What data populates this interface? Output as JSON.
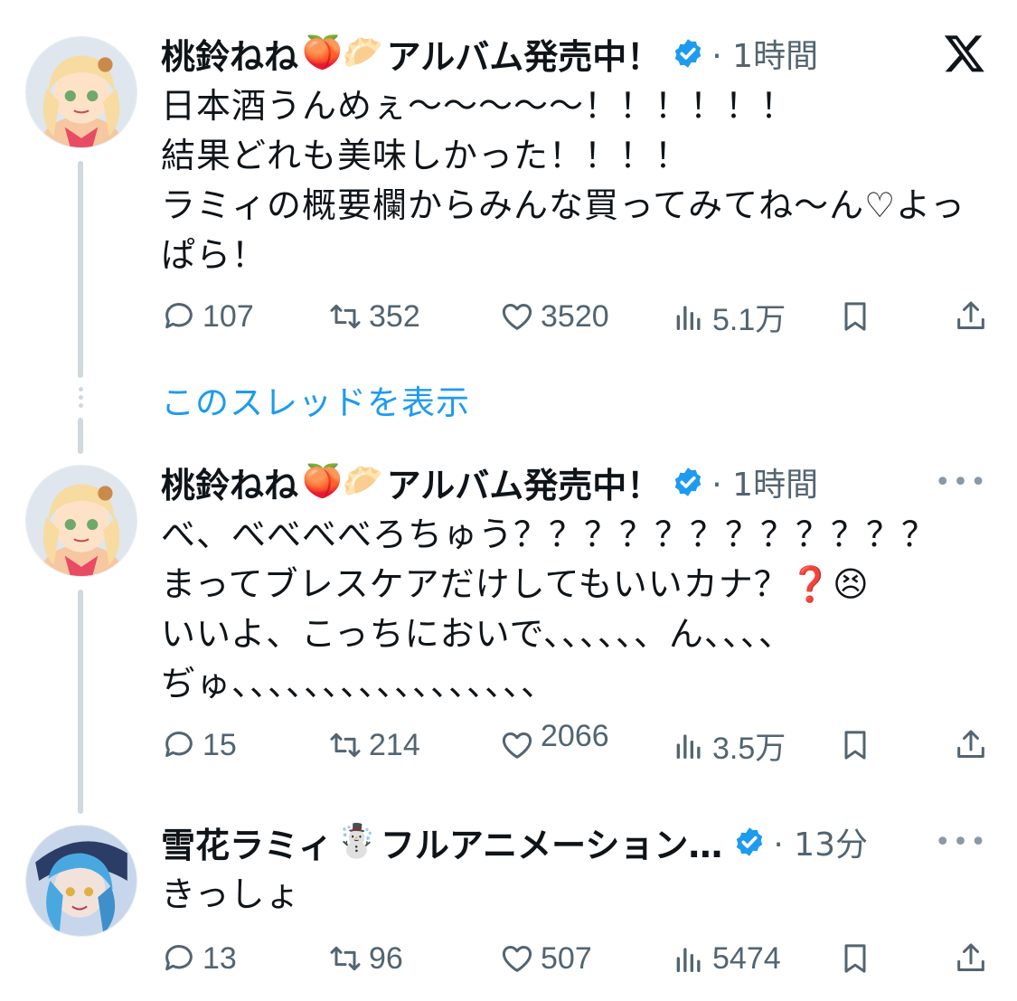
{
  "tweets": [
    {
      "name": "桃鈴ねね",
      "name_emoji": "🍑🥟",
      "name_suffix": "アルバム発売中！",
      "time": "· 1時間",
      "text": "日本酒うんめぇ〜〜〜〜〜！！！！！！\n結果どれも美味しかった！！！！\nラミィの概要欄からみんな買ってみてね〜ん♡よっぱら！",
      "replies": "107",
      "retweets": "352",
      "likes": "3520",
      "views": "5.1万"
    },
    {
      "name": "桃鈴ねね",
      "name_emoji": "🍑🥟",
      "name_suffix": "アルバム発売中！",
      "time": "· 1時間",
      "text": "べ、べべべべろちゅう？？？？？？？？？？？？\nまってブレスケアだけしてもいいカナ？❓😣\nいいよ、こっちにおいで、、、、、、ん、、、、\nぢゅ、、、、、、、、、、、、、、、、、",
      "replies": "15",
      "retweets": "214",
      "likes": "2066",
      "views": "3.5万"
    },
    {
      "name": "雪花ラミィ",
      "name_emoji": "☃️",
      "name_suffix": "フルアニメーション…",
      "time": "· 13分",
      "text": "きっしょ",
      "replies": "13",
      "retweets": "96",
      "likes": "507",
      "views": "5474"
    }
  ],
  "show_thread": "このスレッドを表示",
  "more_label": "•••",
  "colors": {
    "accent": "#1d9bf0",
    "muted": "#536471",
    "line": "#cfd9de"
  },
  "icons": [
    "reply-icon",
    "retweet-icon",
    "like-icon",
    "views-icon",
    "bookmark-icon",
    "share-icon",
    "verified-badge-icon",
    "x-logo-icon"
  ]
}
